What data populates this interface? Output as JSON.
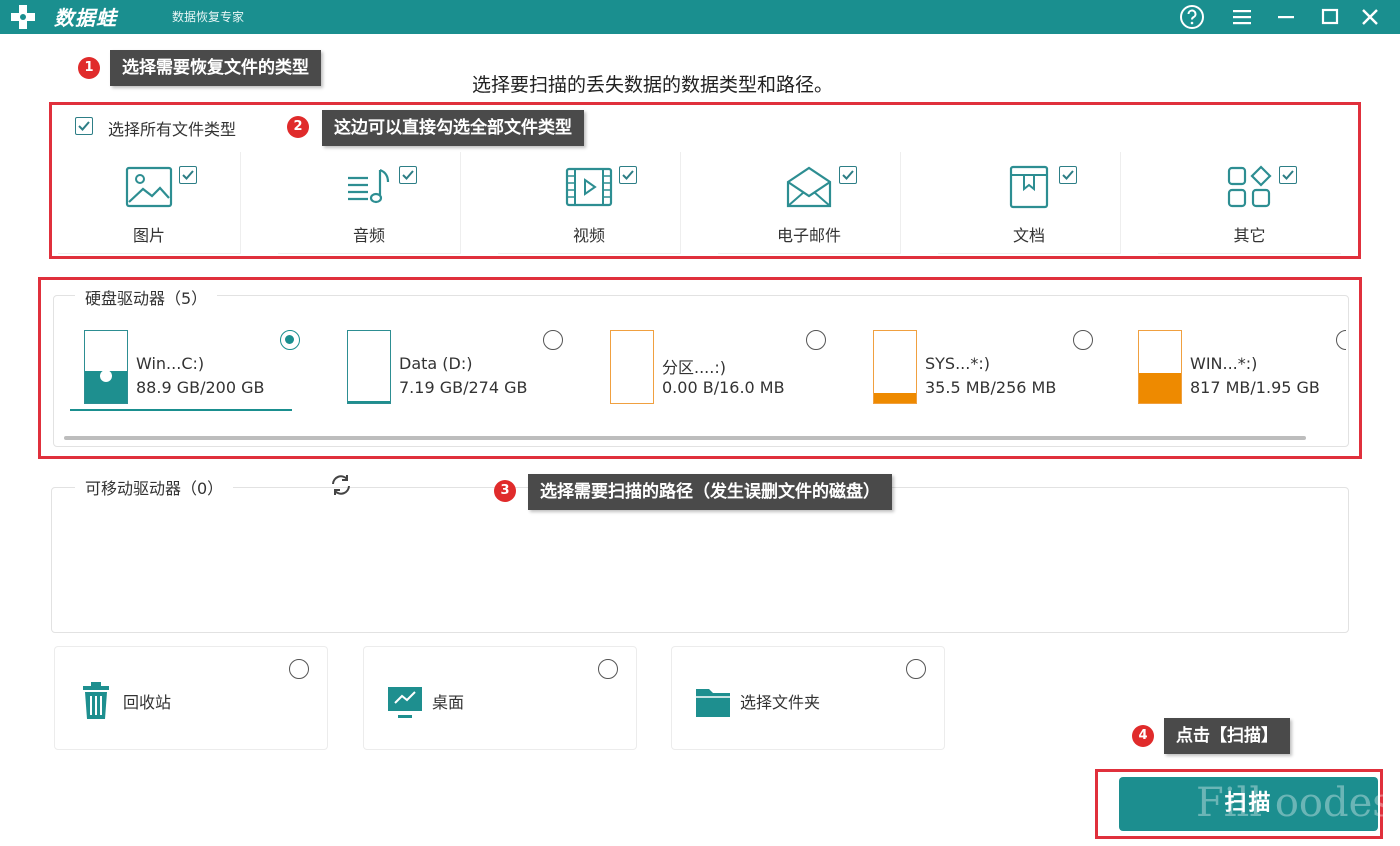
{
  "app": {
    "name": "数据蛙",
    "subtitle": "数据恢复专家"
  },
  "callouts": [
    {
      "num": "1",
      "text": "选择需要恢复文件的类型"
    },
    {
      "num": "2",
      "text": "这边可以直接勾选全部文件类型"
    },
    {
      "num": "3",
      "text": "选择需要扫描的路径（发生误删文件的磁盘）"
    },
    {
      "num": "4",
      "text": "点击【扫描】"
    }
  ],
  "main_title": "选择要扫描的丢失数据的数据类型和路径。",
  "select_all": {
    "label": "选择所有文件类型",
    "checked": true
  },
  "file_types": [
    {
      "label": "图片",
      "icon": "image-icon",
      "checked": true
    },
    {
      "label": "音频",
      "icon": "audio-icon",
      "checked": true
    },
    {
      "label": "视频",
      "icon": "video-icon",
      "checked": true
    },
    {
      "label": "电子邮件",
      "icon": "email-icon",
      "checked": true
    },
    {
      "label": "文档",
      "icon": "document-icon",
      "checked": true
    },
    {
      "label": "其它",
      "icon": "other-icon",
      "checked": true
    }
  ],
  "hard_drives": {
    "title": "硬盘驱动器（5）",
    "items": [
      {
        "name": "Win...C:)",
        "size": "88.9 GB/200 GB",
        "used_fraction": 0.44,
        "selected": true,
        "color": "#1e8f8f"
      },
      {
        "name": "Data (D:)",
        "size": "7.19 GB/274 GB",
        "used_fraction": 0.03,
        "selected": false,
        "color": "#1e8f8f"
      },
      {
        "name": "分区....:)",
        "size": "0.00  B/16.0 MB",
        "used_fraction": 0.0,
        "selected": false,
        "color": "#f0a040"
      },
      {
        "name": "SYS...*:)",
        "size": "35.5 MB/256 MB",
        "used_fraction": 0.14,
        "selected": false,
        "color": "#ee8a00"
      },
      {
        "name": "WIN...*:)",
        "size": "817 MB/1.95 GB",
        "used_fraction": 0.41,
        "selected": false,
        "color": "#ee8a00"
      }
    ]
  },
  "removable_drives": {
    "title": "可移动驱动器（0）"
  },
  "locations": [
    {
      "label": "回收站",
      "icon": "recycle-bin-icon",
      "selected": false
    },
    {
      "label": "桌面",
      "icon": "desktop-icon",
      "selected": false
    },
    {
      "label": "选择文件夹",
      "icon": "folder-icon",
      "selected": false
    }
  ],
  "scan_button": {
    "label": "扫描"
  },
  "watermark": "Fill oodes",
  "colors": {
    "accent": "#1a8f8f",
    "highlight_border": "#e0303c",
    "callout_bg": "#4a4a4a",
    "badge": "#e02b2b"
  }
}
